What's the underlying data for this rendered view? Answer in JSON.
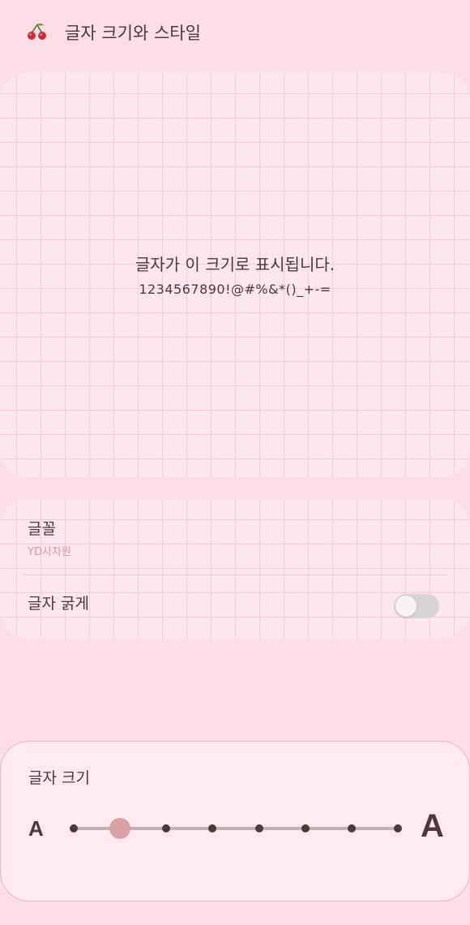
{
  "header": {
    "title": "글자 크기와 스타일",
    "icon": "cherry-icon"
  },
  "preview": {
    "text": "글자가 이 크기로 표시됩니다.",
    "sample": "1234567890!@#%&*()_+-="
  },
  "settings": {
    "font_label": "글꼴",
    "font_value": "YD사차원",
    "bold_label": "글자 굵게",
    "bold_enabled": false
  },
  "size_panel": {
    "title": "글자 크기",
    "small_label": "A",
    "large_label": "A",
    "level_count": 8,
    "selected_level": 2
  },
  "colors": {
    "background": "#fadde5",
    "accent": "#d9a0a5",
    "text": "#4a3a3c",
    "subtext": "#d79aa3"
  }
}
